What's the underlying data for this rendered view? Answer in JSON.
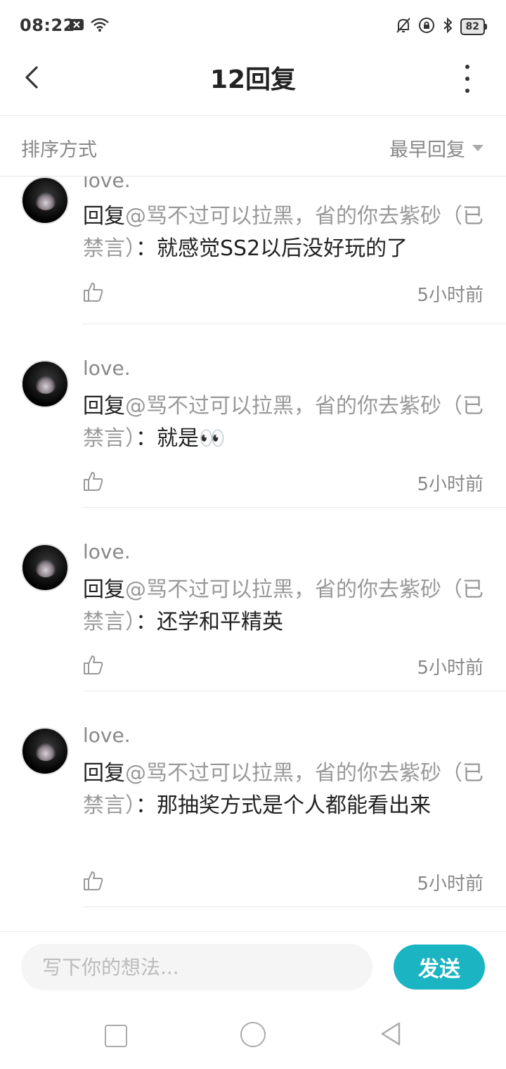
{
  "status_bar": {
    "time": "08:22",
    "battery": "82"
  },
  "header": {
    "title": "12回复"
  },
  "sort": {
    "label": "排序方式",
    "value": "最早回复"
  },
  "comments": [
    {
      "username": "love.",
      "reply_prefix": "回复",
      "mention": "@骂不过可以拉黑，省的你去紫砂（已禁言）",
      "colon": "：",
      "text": "就感觉SS2以后没好玩的了",
      "time": "5小时前"
    },
    {
      "username": "love.",
      "reply_prefix": "回复",
      "mention": "@骂不过可以拉黑，省的你去紫砂（已禁言）",
      "colon": "：",
      "text": "就是👀",
      "time": "5小时前"
    },
    {
      "username": "love.",
      "reply_prefix": "回复",
      "mention": "@骂不过可以拉黑，省的你去紫砂（已禁言）",
      "colon": "：",
      "text": "还学和平精英",
      "time": "5小时前"
    },
    {
      "username": "love.",
      "reply_prefix": "回复",
      "mention": "@骂不过可以拉黑，省的你去紫砂（已禁言）",
      "colon": "：",
      "text": "那抽奖方式是个人都能看出来",
      "time": "5小时前"
    }
  ],
  "input": {
    "placeholder": "写下你的想法...",
    "send_label": "发送"
  },
  "colors": {
    "accent": "#1ab4c2",
    "muted_text": "#888888"
  }
}
